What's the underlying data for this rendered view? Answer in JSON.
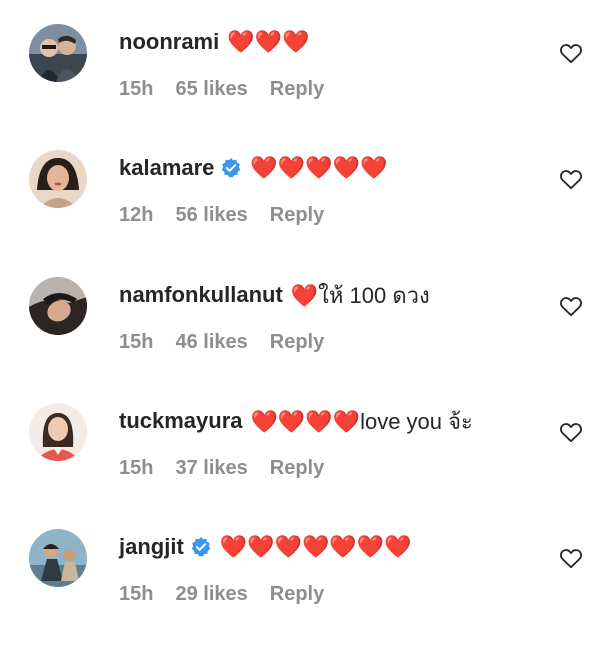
{
  "comments": [
    {
      "username": "noonrami",
      "verified": false,
      "text": "❤️❤️❤️",
      "time": "15h",
      "likes": "65 likes",
      "reply": "Reply",
      "avatar_icon": "avatar-photo"
    },
    {
      "username": "kalamare",
      "verified": true,
      "text": "❤️❤️❤️❤️❤️",
      "time": "12h",
      "likes": "56 likes",
      "reply": "Reply",
      "avatar_icon": "avatar-photo"
    },
    {
      "username": "namfonkullanut",
      "verified": false,
      "text": "❤️ให้ 100 ดวง",
      "time": "15h",
      "likes": "46 likes",
      "reply": "Reply",
      "avatar_icon": "avatar-photo"
    },
    {
      "username": "tuckmayura",
      "verified": false,
      "text": "❤️❤️❤️❤️love you จ้ะ",
      "time": "15h",
      "likes": "37 likes",
      "reply": "Reply",
      "avatar_icon": "avatar-photo"
    },
    {
      "username": "jangjit",
      "verified": true,
      "text": "❤️❤️❤️❤️❤️❤️❤️",
      "time": "15h",
      "likes": "29 likes",
      "reply": "Reply",
      "avatar_icon": "avatar-photo"
    }
  ],
  "colors": {
    "username": "#262626",
    "meta": "#8e8e8e",
    "verified": "#3897f0",
    "heart_red": "#ed4956"
  },
  "icons": {
    "like": "heart-outline-icon",
    "verified": "verified-badge-icon"
  }
}
